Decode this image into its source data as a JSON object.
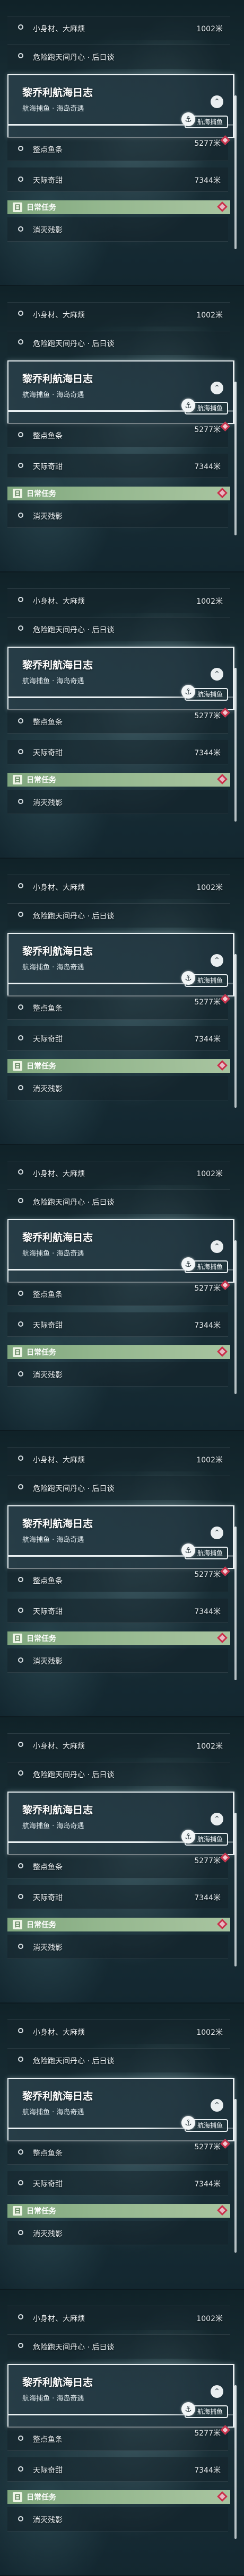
{
  "quests": {
    "q1": {
      "name": "小身材、大麻烦",
      "distance": "1002米"
    },
    "q2": {
      "name": "危险跑天间丹心 · 后日谈",
      "distance": ""
    }
  },
  "log": {
    "title": "黎乔利航海日志",
    "subtitle": "航海捕鱼 · 海岛奇遇",
    "badge": "航海捕鱼",
    "expand_icon": "chevron-up-icon"
  },
  "subquests": {
    "s1": {
      "name": "整点鱼条",
      "distance": "5277米"
    },
    "s2": {
      "name": "天际奇甜",
      "distance": "7344米"
    }
  },
  "daily": {
    "label": "日常任务",
    "icon": "日",
    "quest": {
      "name": "消灭残影"
    }
  },
  "colors": {
    "accent_green": "#8fb389",
    "marker_red": "#c8304a",
    "text": "#eef3f5"
  }
}
